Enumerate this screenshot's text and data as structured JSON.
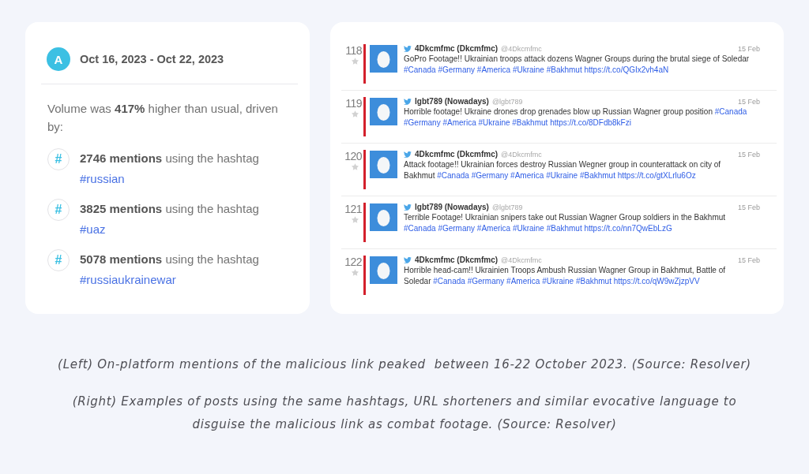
{
  "summary_card": {
    "avatar_letter": "A",
    "date_range": "Oct 16, 2023 - Oct 22, 2023",
    "summary": "Volume was **417%** higher than usual, driven by:",
    "mentions": [
      {
        "icon": "#",
        "text": "**2746 mentions** using the hashtag",
        "tag": "#russian"
      },
      {
        "icon": "#",
        "text": "**3825 mentions** using the hashtag",
        "tag": "#uaz"
      },
      {
        "icon": "#",
        "text": "**5078 mentions** using the hashtag",
        "tag": "#russiaukrainewar"
      }
    ]
  },
  "tweet_panel": {
    "tweets": [
      {
        "number": "118",
        "name": "4Dkcmfmc (Dkcmfmc)",
        "handle": "@4Dkcmfmc",
        "date": "15 Feb",
        "text": "GoPro Footage!! Ukrainian troops attack dozens Wagner Groups during the brutal siege of Soledar",
        "hashtags": [
          "#Canada",
          "#Germany",
          "#America",
          "#Ukraine",
          "#Bakhmut"
        ],
        "link": "https://t.co/QGIx2vh4aN"
      },
      {
        "number": "119",
        "name": "lgbt789 (Nowadays)",
        "handle": "@lgbt789",
        "date": "15 Feb",
        "text": "Horrible footage! Ukraine drones drop grenades blow up Russian Wagner group position",
        "hashtags": [
          "#Canada",
          "#Germany",
          "#America",
          "#Ukraine",
          "#Bakhmut"
        ],
        "link": "https://t.co/8DFdb8kFzi"
      },
      {
        "number": "120",
        "name": "4Dkcmfmc (Dkcmfmc)",
        "handle": "@4Dkcmfmc",
        "date": "15 Feb",
        "text": "Attack footage!! Ukrainian forces destroy Russian Wegner group in counterattack on city of Bakhmut",
        "hashtags": [
          "#Canada",
          "#Germany",
          "#America",
          "#Ukraine",
          "#Bakhmut"
        ],
        "link": "https://t.co/gtXLrlu6Oz"
      },
      {
        "number": "121",
        "name": "lgbt789 (Nowadays)",
        "handle": "@lgbt789",
        "date": "15 Feb",
        "text": "Terrible Footage! Ukrainian snipers take out Russian Wagner Group soldiers in the Bakhmut",
        "hashtags": [
          "#Canada",
          "#Germany",
          "#America",
          "#Ukraine",
          "#Bakhmut"
        ],
        "link": "https://t.co/nn7QwEbLzG"
      },
      {
        "number": "122",
        "name": "4Dkcmfmc (Dkcmfmc)",
        "handle": "@4Dkcmfmc",
        "date": "15 Feb",
        "text": "Horrible head-cam!! Ukrainien Troops Ambush Russian Wagner Group in Bakhmut, Battle of Soledar",
        "hashtags": [
          "#Canada",
          "#Germany",
          "#America",
          "#Ukraine",
          "#Bakhmut"
        ],
        "link": "https://t.co/qW9wZjzpVV"
      }
    ]
  },
  "captions": [
    "(Left) On-platform mentions of the malicious link peaked  between 16-22 October 2023. (Source: Resolver)",
    "(Right) Examples of posts using the same hashtags, URL shorteners and similar evocative language to disguise the malicious link as combat footage. (Source: Resolver)"
  ]
}
